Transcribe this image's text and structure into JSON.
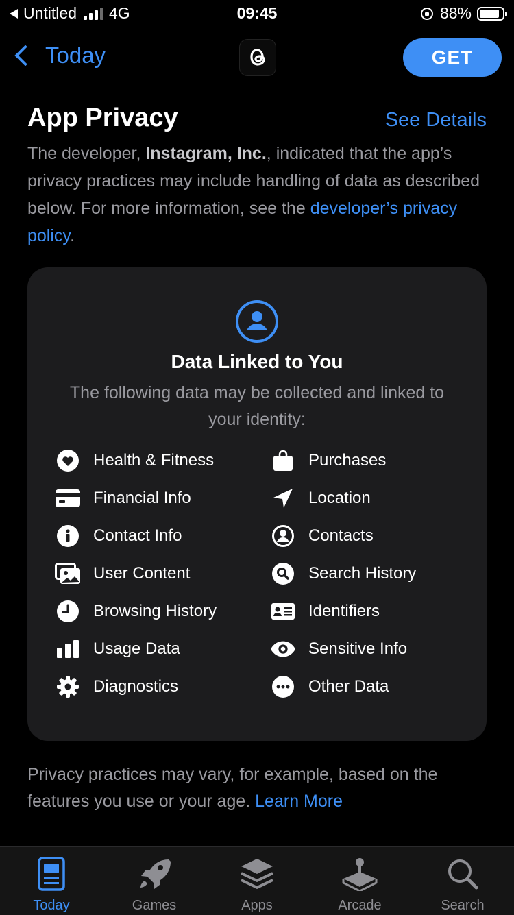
{
  "status_bar": {
    "carrier": "Untitled",
    "network": "4G",
    "time": "09:45",
    "battery": "88%"
  },
  "nav": {
    "back_label": "Today",
    "get_label": "GET"
  },
  "privacy": {
    "title": "App Privacy",
    "see_details": "See Details",
    "desc_prefix": "The developer, ",
    "developer": "Instagram, Inc.",
    "desc_suffix": ", indicated that the app’s privacy practices may include handling of data as described below. For more information, see the ",
    "policy_link": "developer’s privacy policy",
    "period": "."
  },
  "card": {
    "title": "Data Linked to You",
    "subtitle": "The following data may be collected and linked to your identity:",
    "items": [
      {
        "label": "Health & Fitness",
        "icon": "heart-icon"
      },
      {
        "label": "Purchases",
        "icon": "bag-icon"
      },
      {
        "label": "Financial Info",
        "icon": "credit-card-icon"
      },
      {
        "label": "Location",
        "icon": "location-arrow-icon"
      },
      {
        "label": "Contact Info",
        "icon": "info-icon"
      },
      {
        "label": "Contacts",
        "icon": "person-circle-icon"
      },
      {
        "label": "User Content",
        "icon": "photos-icon"
      },
      {
        "label": "Search History",
        "icon": "magnifier-circle-icon"
      },
      {
        "label": "Browsing History",
        "icon": "clock-icon"
      },
      {
        "label": "Identifiers",
        "icon": "id-card-icon"
      },
      {
        "label": "Usage Data",
        "icon": "bar-chart-icon"
      },
      {
        "label": "Sensitive Info",
        "icon": "eye-icon"
      },
      {
        "label": "Diagnostics",
        "icon": "gear-icon"
      },
      {
        "label": "Other Data",
        "icon": "ellipsis-circle-icon"
      }
    ]
  },
  "footnote": {
    "text": "Privacy practices may vary, for example, based on the features you use or your age. ",
    "link": "Learn More"
  },
  "tabs": [
    {
      "label": "Today",
      "icon": "today-icon",
      "active": true
    },
    {
      "label": "Games",
      "icon": "rocket-icon",
      "active": false
    },
    {
      "label": "Apps",
      "icon": "layers-icon",
      "active": false
    },
    {
      "label": "Arcade",
      "icon": "joystick-icon",
      "active": false
    },
    {
      "label": "Search",
      "icon": "search-icon",
      "active": false
    }
  ],
  "colors": {
    "accent": "#3e8ff5",
    "background": "#000000",
    "card": "#1c1c1e",
    "secondary_text": "#9a9aa0"
  }
}
